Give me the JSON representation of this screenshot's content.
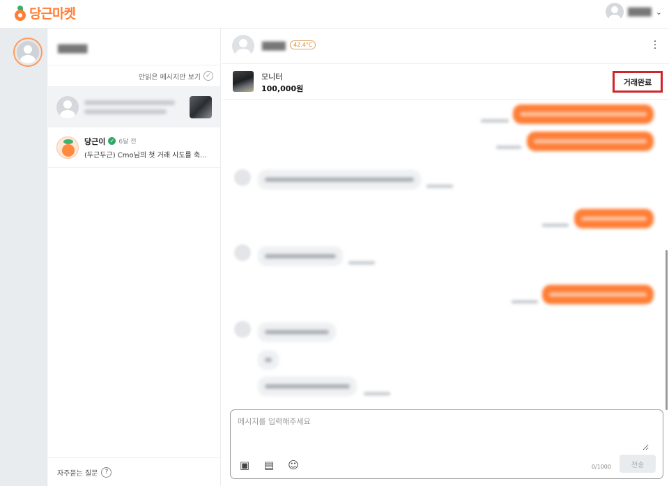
{
  "app": {
    "logo_text": "당근마켓",
    "brand_color": "#ff7e36"
  },
  "topbar": {
    "chevron_icon": "chevron-down-icon"
  },
  "list": {
    "unread_only_label": "안읽은 메시지만 보기",
    "chats": [
      {
        "name": "당근이",
        "time": "6달 전",
        "preview": "(두근두근) Cmo님의 첫 거래 시도를 축..."
      }
    ],
    "faq_label": "자주묻는 질문"
  },
  "panel": {
    "temperature": "42.4°C",
    "product": {
      "title": "모니터",
      "price": "100,000원"
    },
    "deal_complete_label": "거래완료"
  },
  "composer": {
    "placeholder": "메시지를 입력해주세요",
    "char_count": "0/1000",
    "send_label": "전송"
  }
}
